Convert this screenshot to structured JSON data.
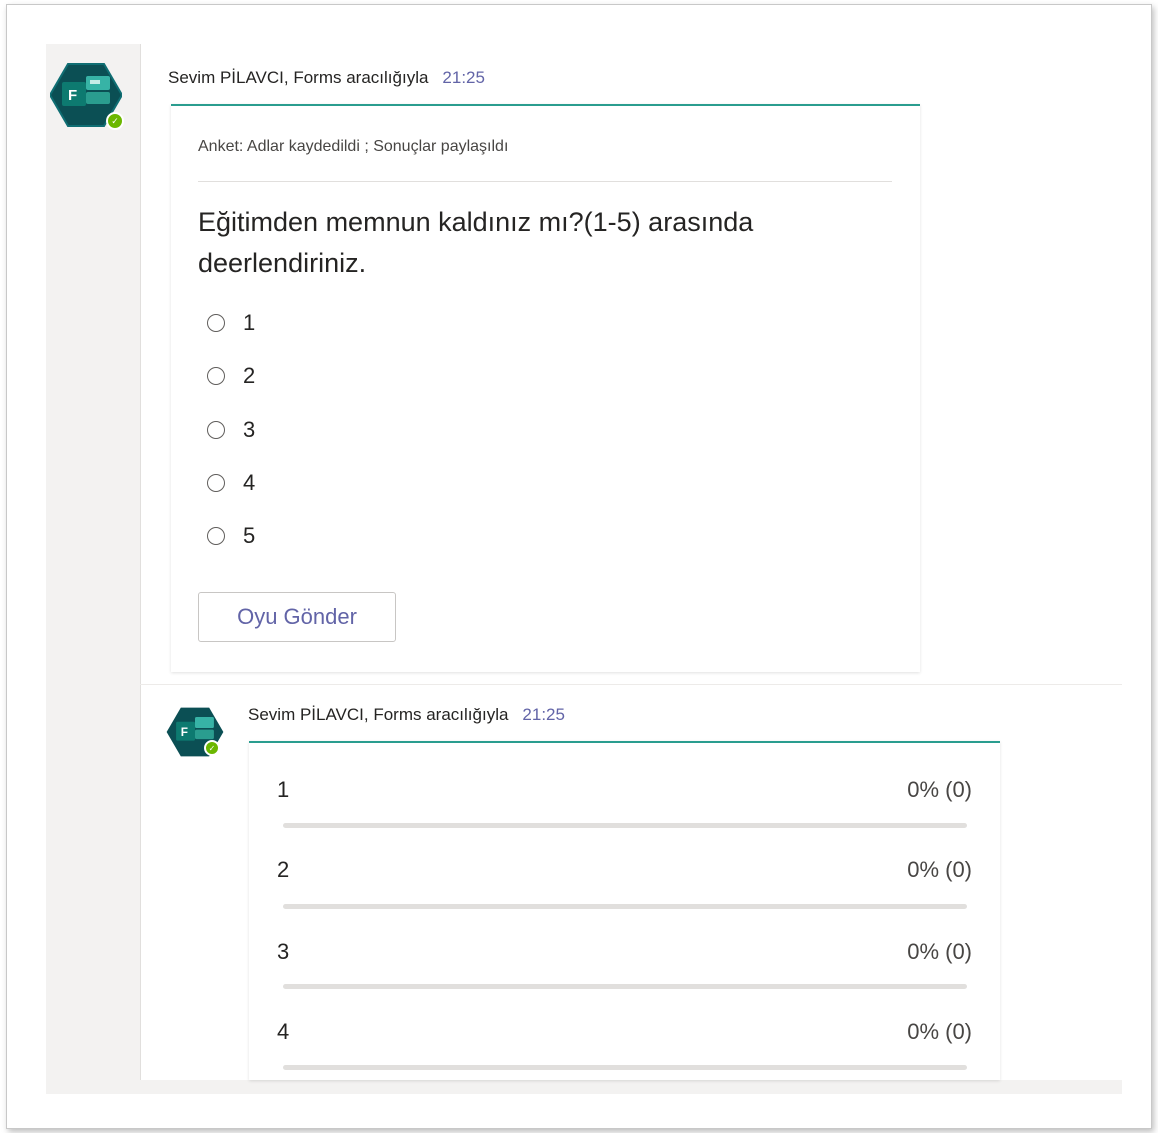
{
  "messages": [
    {
      "sender": "Sevim PİLAVCI, Forms aracılığıyla",
      "time": "21:25",
      "card": {
        "subtitle": "Anket: Adlar kaydedildi ; Sonuçlar paylaşıldı",
        "question": "Eğitimden memnun kaldınız mı?(1-5) arasında deerlendiriniz.",
        "options": [
          "1",
          "2",
          "3",
          "4",
          "5"
        ],
        "submit_label": "Oyu Gönder"
      }
    },
    {
      "sender": "Sevim PİLAVCI, Forms aracılığıyla",
      "time": "21:25",
      "results": [
        {
          "label": "1",
          "value": "0% (0)",
          "fraction": 0
        },
        {
          "label": "2",
          "value": "0% (0)",
          "fraction": 0
        },
        {
          "label": "3",
          "value": "0% (0)",
          "fraction": 0
        },
        {
          "label": "4",
          "value": "0% (0)",
          "fraction": 0
        }
      ]
    }
  ],
  "colors": {
    "accent": "#6264a7",
    "card_border": "#2a9d8f",
    "forms_app": "#077568",
    "status_available": "#6bb700"
  },
  "icons": {
    "app_avatar": "forms-app-icon",
    "presence": "available-check-icon"
  }
}
